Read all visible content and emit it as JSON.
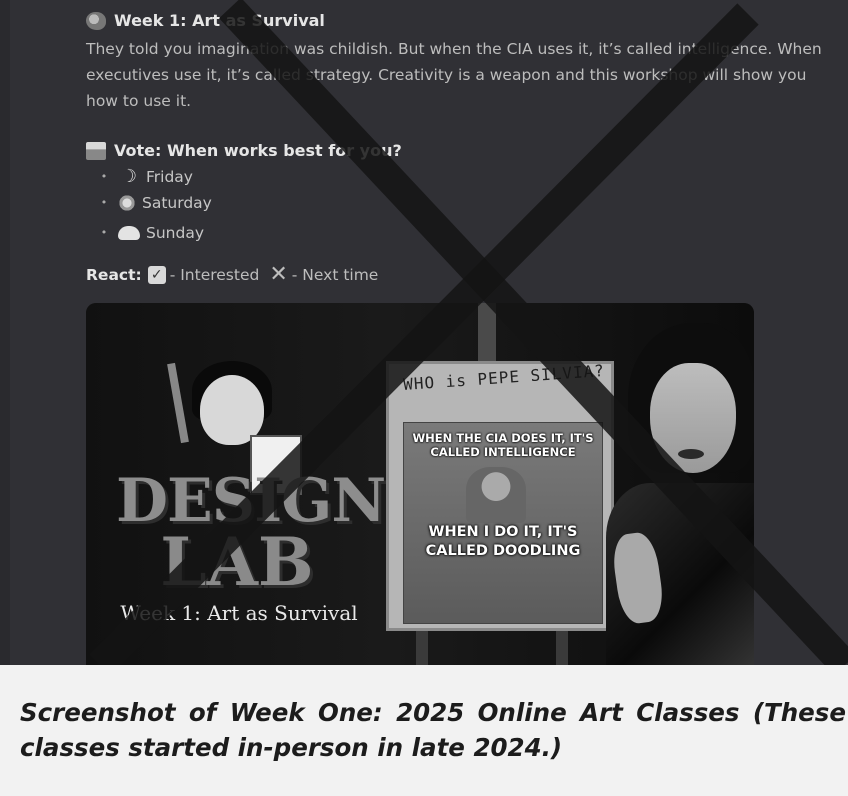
{
  "post": {
    "title": "Week 1: Art as Survival",
    "title_icon": "palette-icon",
    "intro": "They told you imagination was childish. But when the CIA uses it, it’s called intelligence. When executives use it, it’s called strategy. Creativity is a weapon and this workshop will show you how to use it.",
    "vote_title": "Vote: When works best for you?",
    "vote_icon": "ballot-box-icon",
    "vote_options": [
      {
        "icon": "crescent-moon-icon",
        "label": "Friday"
      },
      {
        "icon": "sun-icon",
        "label": "Saturday"
      },
      {
        "icon": "cloud-sun-icon",
        "label": "Sunday"
      }
    ],
    "react_label": "React:",
    "react_yes": "- Interested",
    "react_no": "- Next time"
  },
  "embed": {
    "scribble": "WHO is PEPE SILVIA?",
    "meme_top": "WHEN THE CIA DOES IT, IT'S CALLED INTELLIGENCE",
    "meme_bottom": "WHEN I DO IT, IT'S CALLED DOODLING",
    "logo_line1": "DESIGN",
    "logo_line2": "LAB",
    "logo_sub": "Week 1: Art as Survival"
  },
  "caption": {
    "text": "Screenshot of Week One: 2025 Online Art Classes (These classes started in-person in late 2024.)"
  },
  "colors": {
    "background": "#303035",
    "caption_bg": "#f2f2f2",
    "cross": "#1a1a1a"
  }
}
